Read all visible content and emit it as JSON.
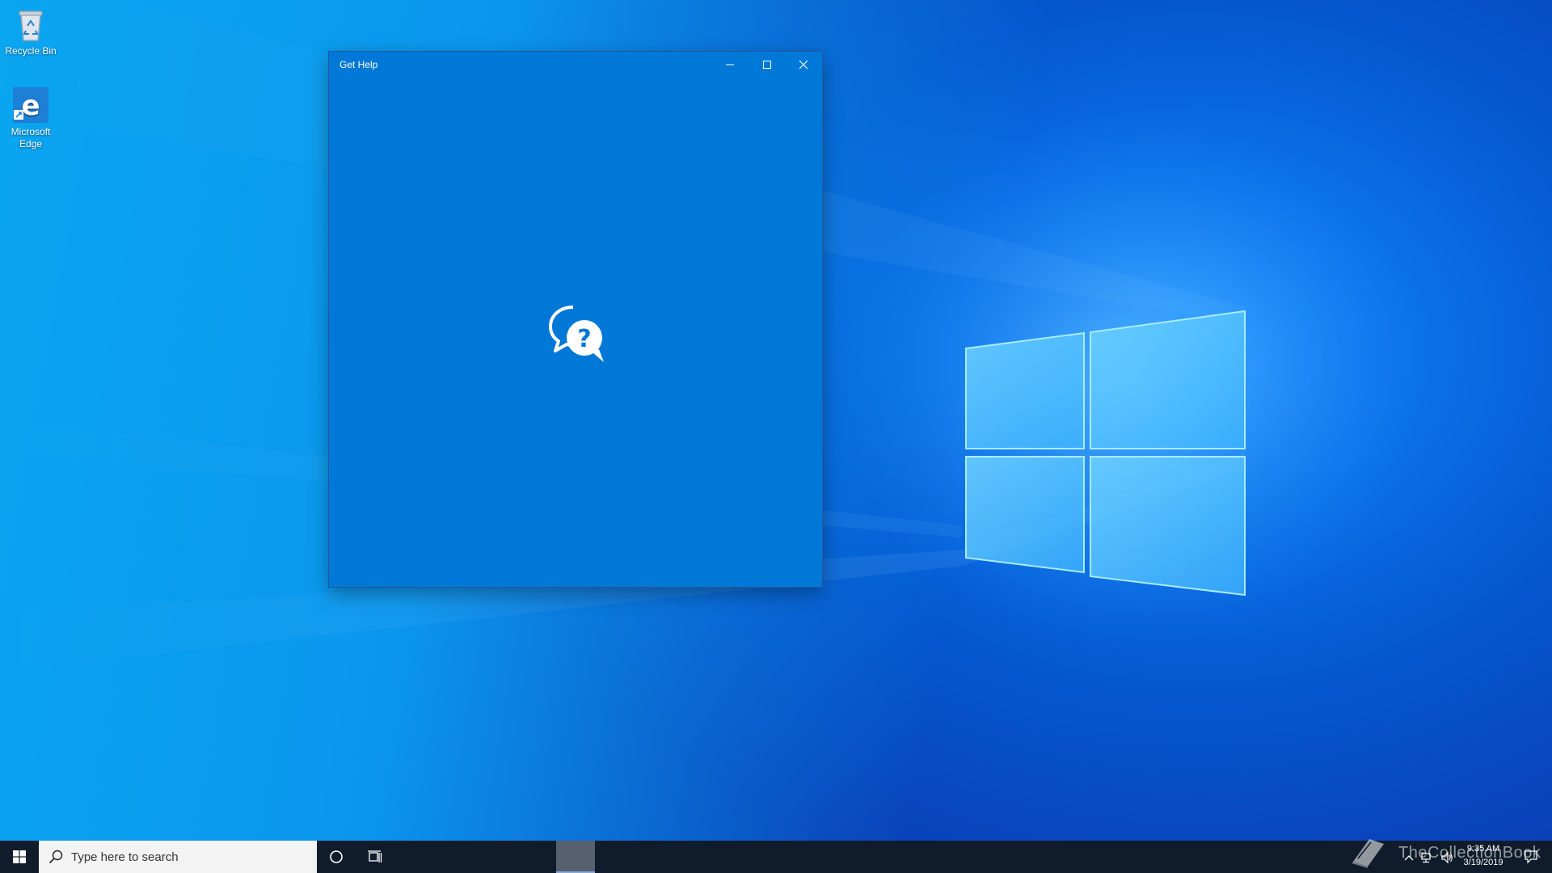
{
  "desktop": {
    "icons": [
      {
        "label": "Recycle Bin",
        "icon": "recycle-bin-icon"
      },
      {
        "label": "Microsoft Edge",
        "icon": "edge-icon"
      }
    ]
  },
  "window": {
    "title": "Get Help",
    "splash_icon": "help-chat-bubbles-icon",
    "background_color": "#0078d7",
    "controls": {
      "minimize": "minimize-icon",
      "maximize": "maximize-icon",
      "close": "close-icon"
    }
  },
  "taskbar": {
    "search_placeholder": "Type here to search",
    "start_icon": "windows-logo-icon",
    "cortana_icon": "cortana-circle-icon",
    "taskview_icon": "task-view-icon",
    "tray": {
      "time": "9:35 AM",
      "date": "3/19/2019"
    }
  },
  "watermark": {
    "text": "TheCollectionBook"
  }
}
